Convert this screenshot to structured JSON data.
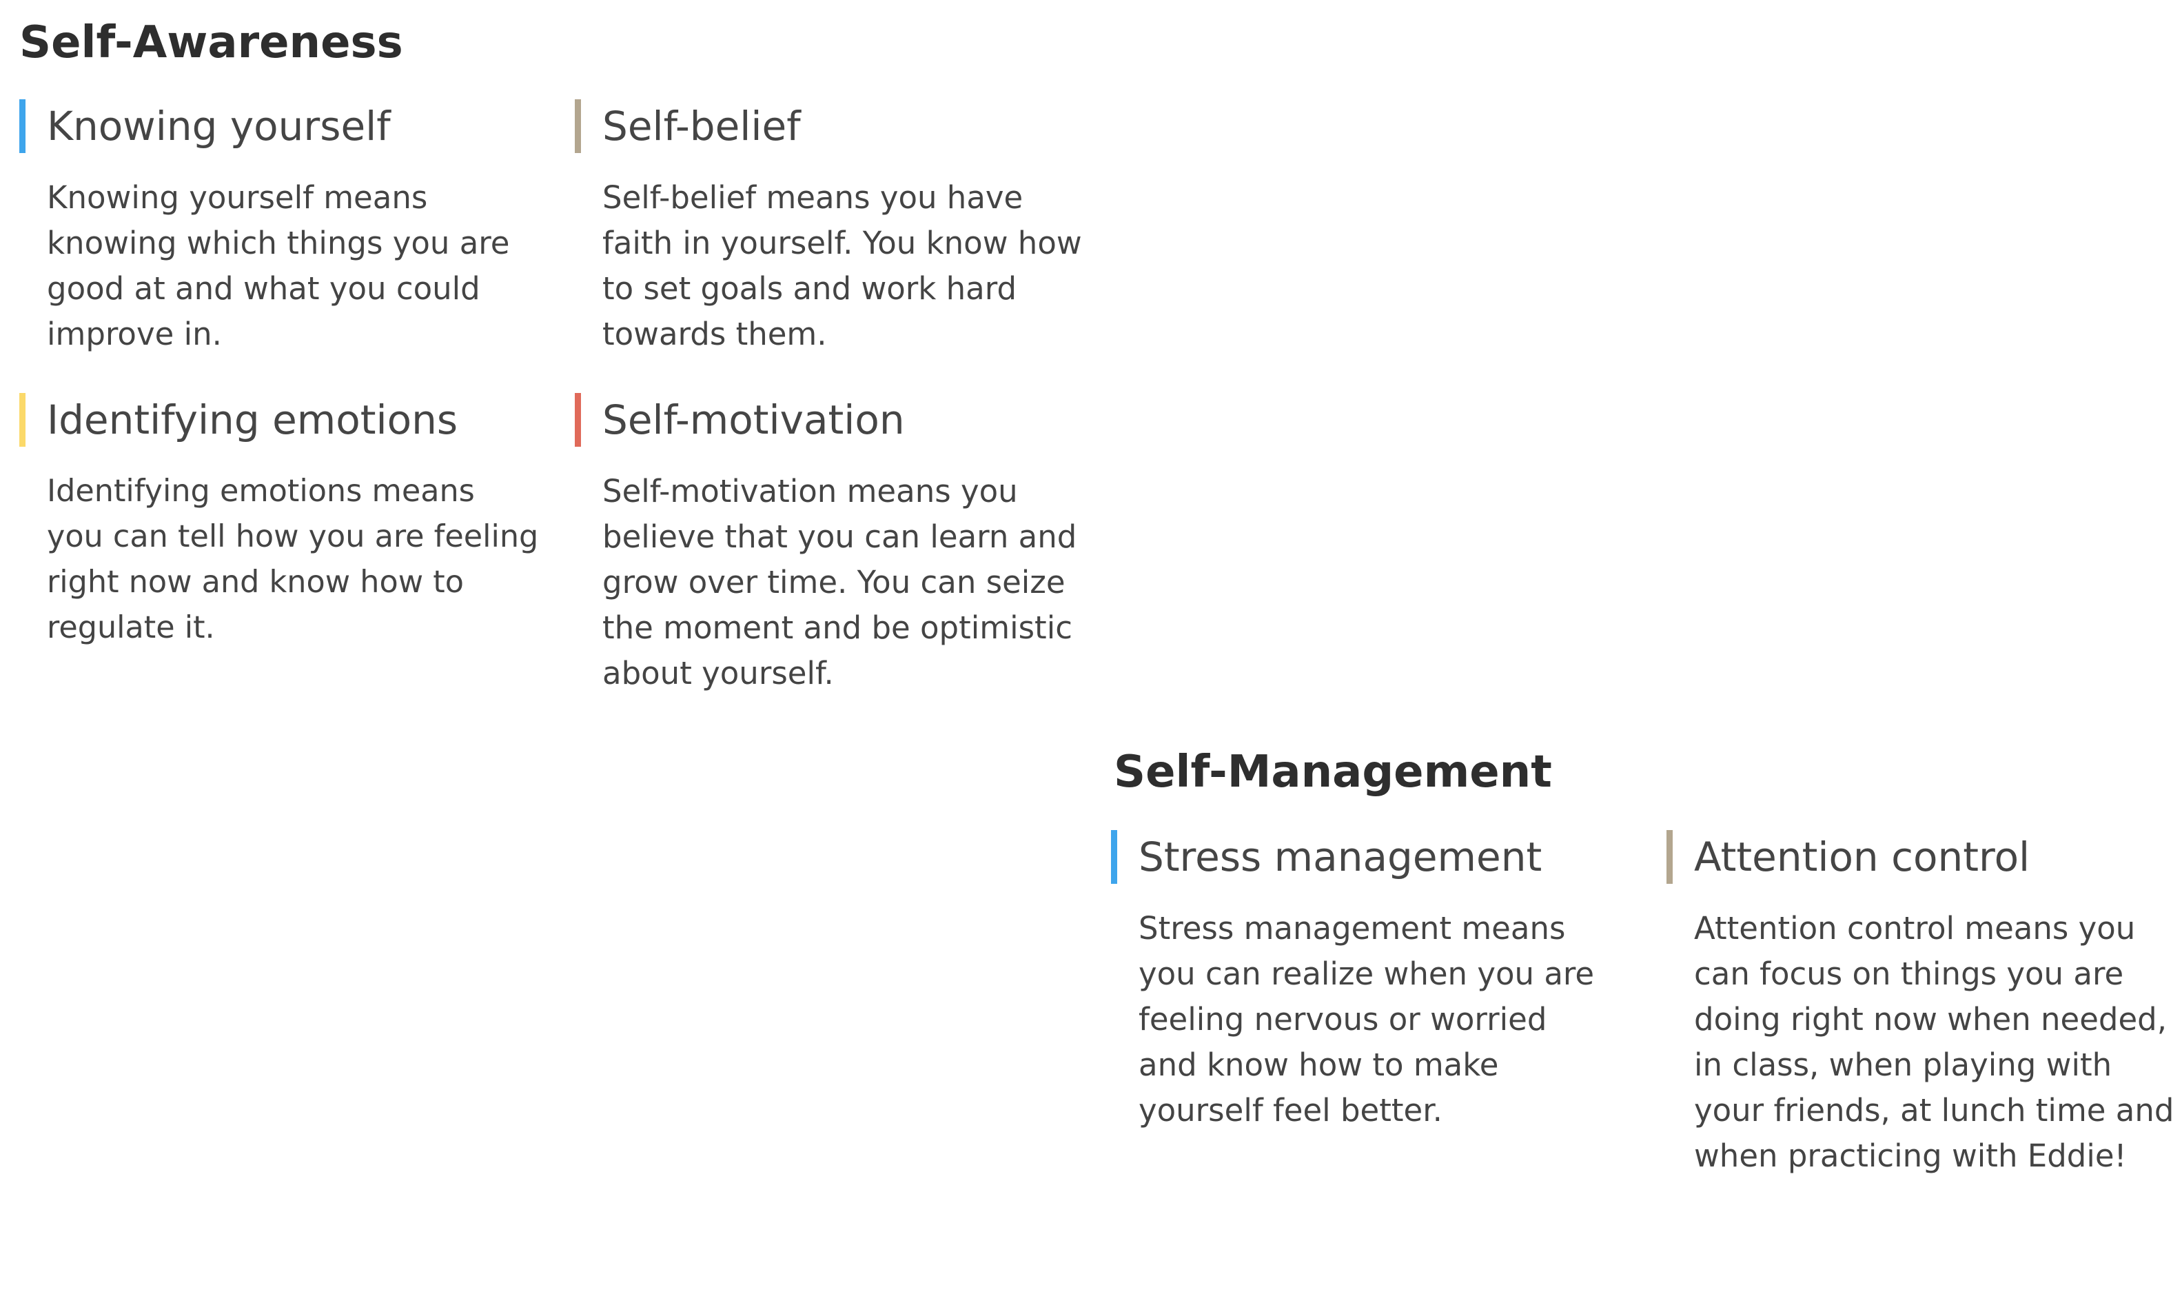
{
  "colors": {
    "blue": "#3ea5ec",
    "tan": "#b3a68f",
    "yellow": "#fbd96a",
    "red": "#e06a5a"
  },
  "sections": [
    {
      "title": "Self-Awareness",
      "cards": [
        {
          "title": "Knowing yourself",
          "accent": "blue",
          "lines": [
            "Knowing yourself means",
            "knowing which things you are",
            "good at and what you could",
            "improve in."
          ]
        },
        {
          "title": "Self-belief",
          "accent": "tan",
          "lines": [
            "Self-belief means you have",
            "faith in yourself. You know how",
            "to set goals and work hard",
            "towards them."
          ]
        },
        {
          "title": "Identifying emotions",
          "accent": "yellow",
          "lines": [
            "Identifying emotions means",
            "you can tell how you are feeling",
            "right now and know how to",
            "regulate it."
          ]
        },
        {
          "title": "Self-motivation",
          "accent": "red",
          "lines": [
            "Self-motivation means you",
            "believe that you can learn and",
            "grow over time. You can seize",
            "the moment and be optimistic",
            "about yourself."
          ]
        }
      ]
    },
    {
      "title": "Self-Management",
      "cards": [
        {
          "title": "Stress management",
          "accent": "blue",
          "lines": [
            "Stress management means",
            "you can realize when you are",
            "feeling nervous or worried",
            "and know how to make",
            "yourself feel better."
          ]
        },
        {
          "title": "Attention control",
          "accent": "tan",
          "lines": [
            "Attention control means you",
            "can focus on things you are",
            "doing right now when needed,",
            "in class, when playing with",
            "your friends, at lunch time and",
            "when practicing with Eddie!"
          ]
        }
      ]
    }
  ]
}
